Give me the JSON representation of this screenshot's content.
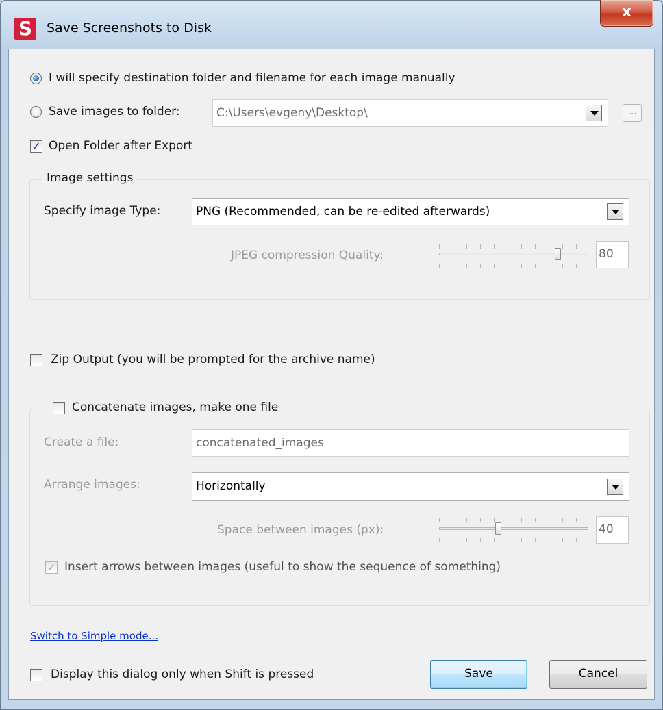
{
  "window": {
    "title": "Save Screenshots to Disk",
    "logo_letter": "S",
    "close_glyph": "x"
  },
  "destination": {
    "manual_label": "I will specify destination folder and filename for each image manually",
    "manual_selected": true,
    "folder_label": "Save images to folder:",
    "folder_selected": false,
    "folder_value": "C:\\Users\\evgeny\\Desktop\\",
    "browse_label": "...",
    "open_folder_label": "Open Folder after Export",
    "open_folder_checked": true
  },
  "image_settings": {
    "title": "Image settings",
    "type_label": "Specify image Type:",
    "type_value": "PNG   (Recommended, can be re-edited afterwards)",
    "jpeg_label": "JPEG compression Quality:",
    "jpeg_value": "80"
  },
  "zip": {
    "label": "Zip Output (you will be prompted for the archive name)",
    "checked": false
  },
  "concatenate": {
    "label": "Concatenate images, make one file",
    "checked": false,
    "file_label": "Create a file:",
    "file_value": "concatenated_images",
    "arrange_label": "Arrange images:",
    "arrange_value": "Horizontally",
    "space_label": "Space between images (px):",
    "space_value": "40",
    "arrows_label": "Insert arrows between images (useful to show the sequence of something)",
    "arrows_checked": true
  },
  "footer": {
    "simple_mode_link": "Switch to Simple mode...",
    "shift_label": "Display this dialog only when Shift is pressed",
    "shift_checked": false,
    "save_label": "Save",
    "cancel_label": "Cancel"
  },
  "colors": {
    "link": "#0a33cc",
    "close_button": "#c2391e",
    "default_button_border": "#3c7fb1"
  }
}
